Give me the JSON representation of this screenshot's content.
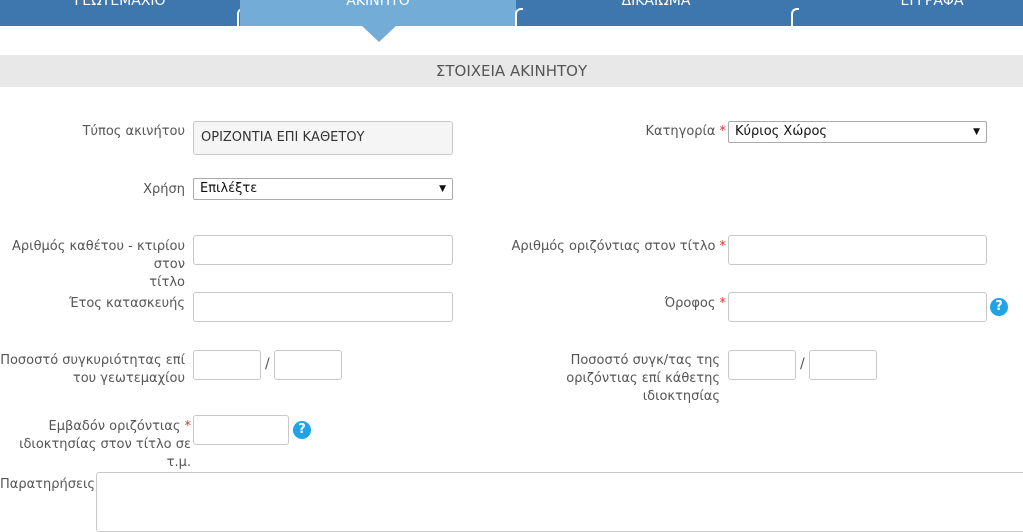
{
  "tabs": [
    {
      "label": "ΓΕΩΤΕΜΑΧΙΟ",
      "active": false
    },
    {
      "label": "ΑΚΙΝΗΤΟ",
      "active": true
    },
    {
      "label": "ΔΙΚΑΙΩΜΑ",
      "active": false
    },
    {
      "label": "ΕΓΓΡΑΦΑ",
      "active": false
    }
  ],
  "section_title": "ΣΤΟΙΧΕΙΑ ΑΚΙΝΗΤΟΥ",
  "fields": {
    "property_type": {
      "label": "Τύπος ακινήτου",
      "value": "ΟΡΙΖΟΝΤΙΑ ΕΠΙ ΚΑΘΕΤΟΥ"
    },
    "category": {
      "label": "Κατηγορία",
      "value": "Κύριος Χώρος"
    },
    "use": {
      "label": "Χρήση",
      "value": "Επιλέξτε"
    },
    "vertical_building_number": {
      "label_line1": "Αριθμός καθέτου - κτιρίου στον",
      "label_line2": "τίτλο",
      "value": ""
    },
    "horizontal_number": {
      "label": "Αριθμός οριζόντιας στον τίτλο",
      "value": ""
    },
    "construction_year": {
      "label": "Έτος κατασκευής",
      "value": ""
    },
    "floor": {
      "label": "Όροφος",
      "value": ""
    },
    "coownership_plot": {
      "label_line1": "Ποσοστό συγκυριότητας επί",
      "label_line2": "του γεωτεμαχίου",
      "numerator": "",
      "denominator": "",
      "separator": "/"
    },
    "coownership_horizontal": {
      "label_line1": "Ποσοστό συγκ/τας της",
      "label_line2": "οριζόντιας επί κάθετης",
      "label_line3": "ιδιοκτησίας",
      "numerator": "",
      "denominator": "",
      "separator": "/"
    },
    "area": {
      "label_line1": "Εμβαδόν οριζόντιας",
      "label_line2": "ιδιοκτησίας στον τίτλο σε τ.μ.",
      "value": ""
    },
    "notes": {
      "label": "Παρατηρήσεις",
      "value": ""
    }
  },
  "required_mark": "*",
  "help_glyph": "?",
  "caret_glyph": "▼",
  "colors": {
    "tab_bar": "#3d77ad",
    "tab_active": "#74acd8",
    "required": "#d9332f",
    "help": "#1ea4e6"
  }
}
